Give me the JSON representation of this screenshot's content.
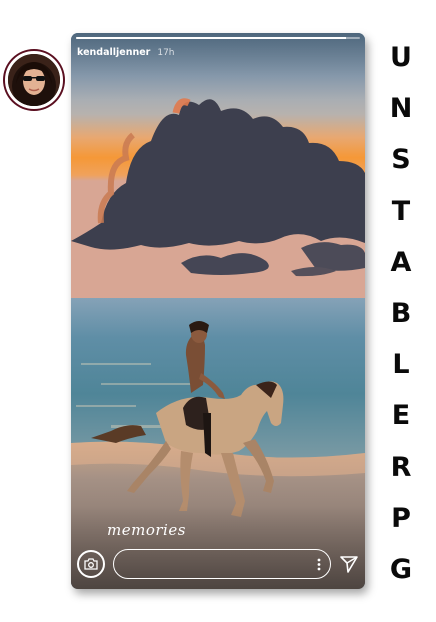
{
  "story": {
    "username": "kendalljenner",
    "time": "17h",
    "caption": "memories",
    "progress": 0.95,
    "reply_placeholder": ""
  },
  "title_letters": [
    "U",
    "N",
    "S",
    "T",
    "A",
    "B",
    "L",
    "E",
    "R",
    "P",
    "G"
  ],
  "icons": {
    "profile": "avatar",
    "camera": "camera-icon",
    "more": "more-vertical-icon",
    "send": "send-icon"
  },
  "colors": {
    "sky_top": "#6b8cab",
    "sunset": "#f39a3a",
    "sea": "#5c8fa8",
    "sand": "#9c8a80",
    "title_text": "#0a0a0a",
    "avatar_ring": "#5a0f20"
  }
}
